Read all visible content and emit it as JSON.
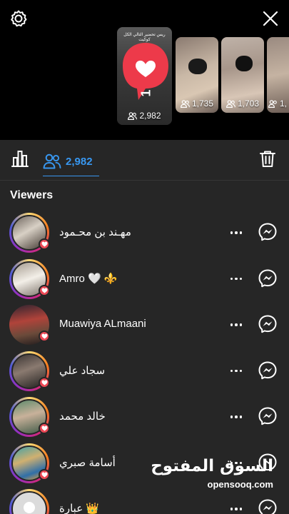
{
  "header": {
    "settings_icon": "gear-icon",
    "close_icon": "close-icon"
  },
  "stories": [
    {
      "count": "2,982",
      "active": true,
      "overlay_text": "ريس تحضير التالي الكل كوكيت",
      "like_count": "1"
    },
    {
      "count": "1,735"
    },
    {
      "count": "1,703"
    },
    {
      "count": "1,"
    }
  ],
  "tabs": {
    "viewers_count": "2,982"
  },
  "section": {
    "title": "Viewers"
  },
  "viewers": [
    {
      "name": "مهـند بن محـمود"
    },
    {
      "name": "Amro 🤍 ⚜️"
    },
    {
      "name": "Muawiya ALmaani"
    },
    {
      "name": "سجاد علي"
    },
    {
      "name": "خالد محمد"
    },
    {
      "name": "أسامة صبري"
    },
    {
      "name": "عبارة 👑"
    }
  ],
  "watermark": {
    "arabic": "السوق المفتوح",
    "english": "opensooq.com"
  },
  "colors": {
    "accent": "#3897f0",
    "like": "#ed4956",
    "sheet": "#262626"
  }
}
